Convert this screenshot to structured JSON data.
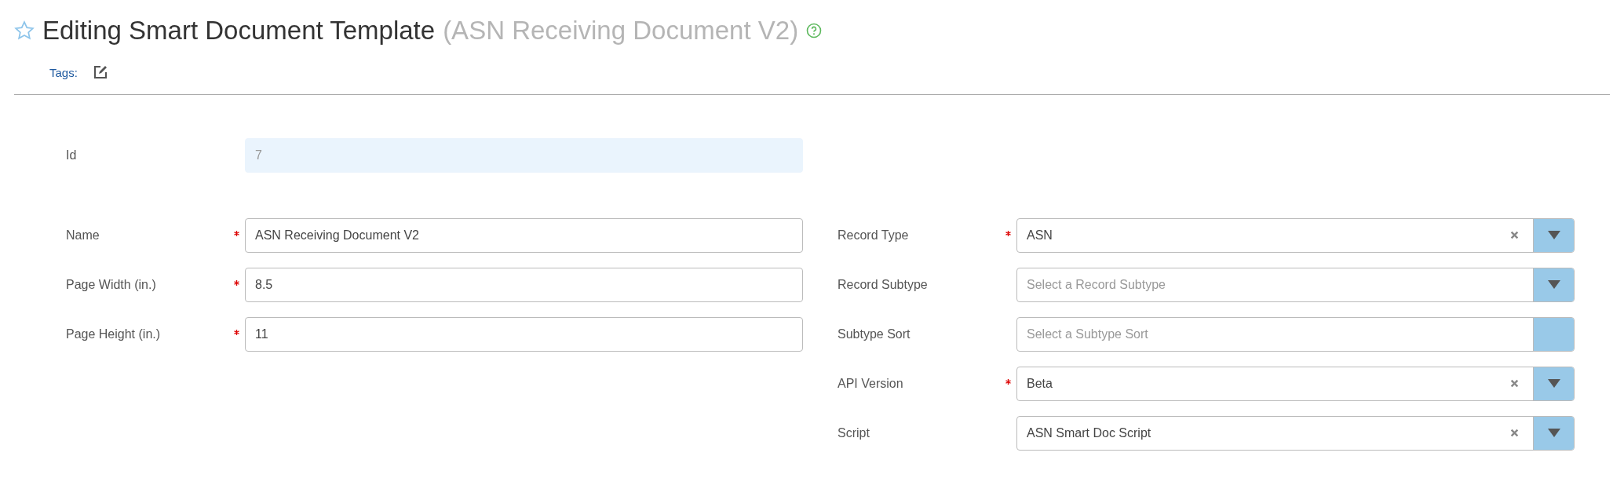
{
  "header": {
    "title": "Editing Smart Document Template",
    "subtitle": "(ASN Receiving Document V2)",
    "starred": false,
    "tags_label": "Tags:"
  },
  "id_field": {
    "label": "Id",
    "value": "7",
    "disabled": true
  },
  "left_fields": [
    {
      "label": "Name",
      "required": true,
      "value": "ASN Receiving Document V2"
    },
    {
      "label": "Page Width (in.)",
      "required": true,
      "value": "8.5"
    },
    {
      "label": "Page Height (in.)",
      "required": true,
      "value": "11"
    }
  ],
  "right_fields": [
    {
      "label": "Record Type",
      "required": true,
      "value": "ASN",
      "clearable": true,
      "has_arrow": true
    },
    {
      "label": "Record Subtype",
      "required": false,
      "placeholder": "Select a Record Subtype",
      "clearable": false,
      "has_arrow": true
    },
    {
      "label": "Subtype Sort",
      "required": false,
      "placeholder": "Select a Subtype Sort",
      "clearable": false,
      "has_arrow": false
    },
    {
      "label": "API Version",
      "required": true,
      "value": "Beta",
      "clearable": true,
      "has_arrow": true
    },
    {
      "label": "Script",
      "required": false,
      "value": "ASN Smart Doc Script",
      "clearable": true,
      "has_arrow": true
    }
  ]
}
